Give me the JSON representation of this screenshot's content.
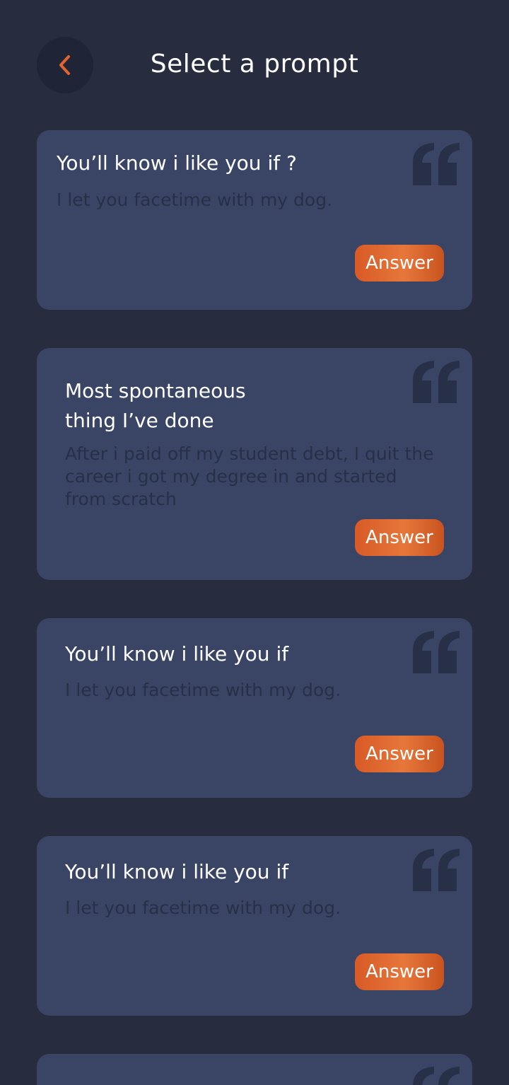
{
  "header": {
    "title": "Select a prompt",
    "back_icon": "chevron-left-icon",
    "accent_color": "#e2652f"
  },
  "prompts": [
    {
      "question": "You’ll know i like you if ?",
      "answer": "I let you facetime with my dog.",
      "button": "Answer"
    },
    {
      "question_lines": [
        "Most spontaneous",
        "thing I’ve done"
      ],
      "answer_lines": [
        "After i paid off my student debt, I quit the",
        "career i got my degree in and started",
        "from scratch"
      ],
      "button": "Answer"
    },
    {
      "question": "You’ll know i like you if",
      "answer": "I let you facetime with my dog.",
      "button": "Answer"
    },
    {
      "question": "You’ll know i like you if",
      "answer": "I let you facetime with my dog.",
      "button": "Answer"
    }
  ],
  "colors": {
    "background": "#272d3f",
    "card": "#3a4566",
    "quote_icon": "#283047",
    "button": "#e2652f"
  }
}
